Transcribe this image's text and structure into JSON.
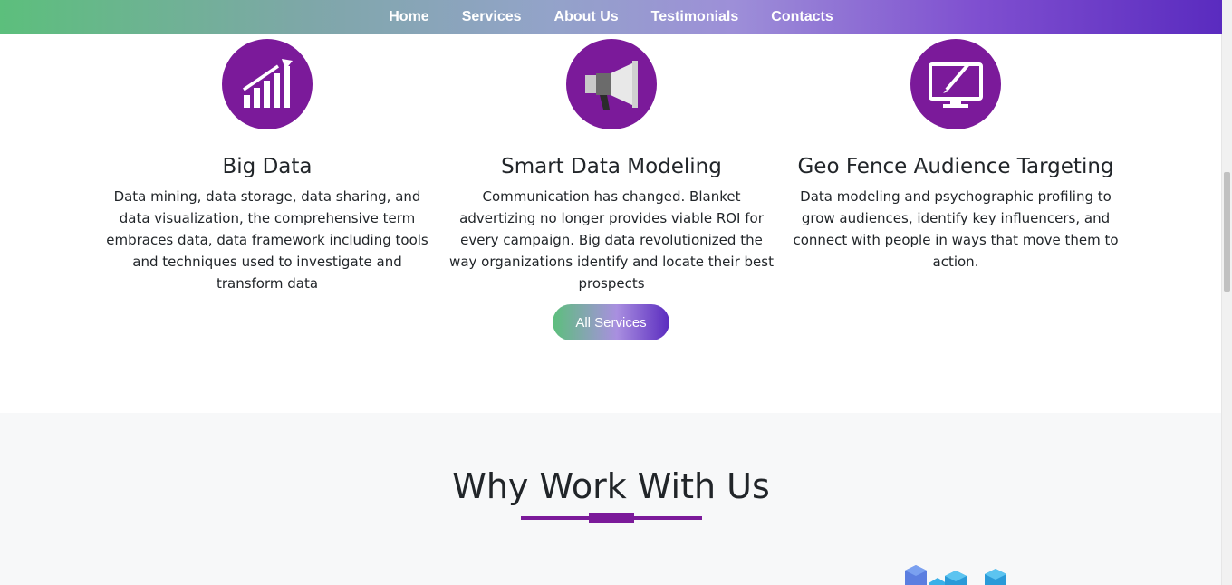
{
  "nav": {
    "links": [
      "Home",
      "Services",
      "About Us",
      "Testimonials",
      "Contacts"
    ]
  },
  "services": [
    {
      "icon": "growth-chart-icon",
      "title": "Big Data",
      "description": "Data mining, data storage, data sharing, and data visualization, the comprehensive term embraces data, data framework including tools and techniques used to investigate and transform data"
    },
    {
      "icon": "megaphone-icon",
      "title": "Smart Data Modeling",
      "description": "Communication has changed. Blanket advertizing no longer provides viable ROI for every campaign. Big data revolutionized the way organizations identify and locate their best prospects"
    },
    {
      "icon": "monitor-pen-icon",
      "title": "Geo Fence Audience Targeting",
      "description": "Data modeling and psychographic profiling to grow audiences, identify key influencers, and connect with people in ways that move them to action."
    }
  ],
  "all_services_label": "All Services",
  "why": {
    "title": "Why Work With Us"
  },
  "colors": {
    "accent": "#7b1a9a",
    "gradient_start": "#5cbf7c",
    "gradient_end": "#5a2bbf",
    "section_bg": "#f7f8f9"
  }
}
